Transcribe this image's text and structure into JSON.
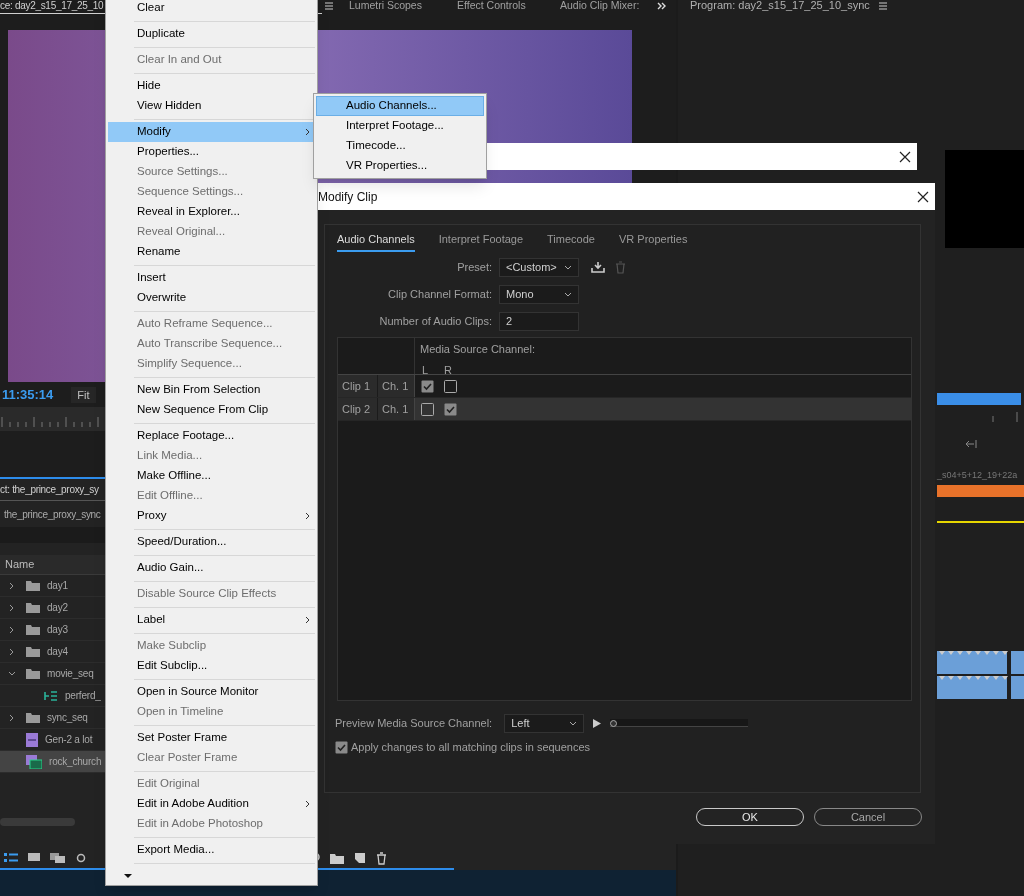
{
  "app": {
    "source_tab": {
      "label": "ce: day2_s15_17_25_10",
      "selected": true
    },
    "panel_tabs": [
      {
        "label": "Lumetri Scopes",
        "selected": false
      },
      {
        "label": "Effect Controls",
        "selected": false
      },
      {
        "label": "Audio Clip Mixer:",
        "selected": false
      }
    ],
    "program_tab": "Program: day2_s15_17_25_10_sync",
    "source_timecode": "11:35:14",
    "zoom": "Fit",
    "project_title": "ct: the_prince_proxy_sy",
    "project_path": "the_prince_proxy_sync",
    "name_column": "Name",
    "items": [
      {
        "kind": "folder",
        "label": "day1",
        "expanded": false,
        "selected": false
      },
      {
        "kind": "folder",
        "label": "day2",
        "expanded": false,
        "selected": false
      },
      {
        "kind": "folder",
        "label": "day3",
        "expanded": false,
        "selected": false
      },
      {
        "kind": "folder",
        "label": "day4",
        "expanded": false,
        "selected": false
      },
      {
        "kind": "folder",
        "label": "movie_seq",
        "expanded": true,
        "selected": false,
        "children": [
          {
            "kind": "sequence",
            "label": "perferd_",
            "selected": false
          }
        ]
      },
      {
        "kind": "folder",
        "label": "sync_seq",
        "expanded": false,
        "selected": false
      },
      {
        "kind": "clip",
        "label": "Gen-2 a lot",
        "selected": false
      },
      {
        "kind": "multicam",
        "label": "rock_church",
        "selected": true
      }
    ],
    "timeline_clip": "_s04+5+12_19+22a"
  },
  "context_menu": {
    "groups": [
      [
        {
          "label": "Clear",
          "disabled": false,
          "selected": false,
          "submenu": false
        }
      ],
      [
        {
          "label": "Duplicate",
          "disabled": false,
          "selected": false,
          "submenu": false
        }
      ],
      [
        {
          "label": "Clear In and Out",
          "disabled": true,
          "selected": false,
          "submenu": false
        }
      ],
      [
        {
          "label": "Hide",
          "disabled": false,
          "selected": false,
          "submenu": false
        },
        {
          "label": "View Hidden",
          "disabled": false,
          "selected": false,
          "submenu": false
        }
      ],
      [
        {
          "label": "Modify",
          "disabled": false,
          "selected": true,
          "submenu": true
        },
        {
          "label": "Properties...",
          "disabled": false,
          "selected": false,
          "submenu": false
        },
        {
          "label": "Source Settings...",
          "disabled": true,
          "selected": false,
          "submenu": false
        },
        {
          "label": "Sequence Settings...",
          "disabled": true,
          "selected": false,
          "submenu": false
        },
        {
          "label": "Reveal in Explorer...",
          "disabled": false,
          "selected": false,
          "submenu": false
        },
        {
          "label": "Reveal Original...",
          "disabled": true,
          "selected": false,
          "submenu": false
        },
        {
          "label": "Rename",
          "disabled": false,
          "selected": false,
          "submenu": false
        }
      ],
      [
        {
          "label": "Insert",
          "disabled": false,
          "selected": false,
          "submenu": false
        },
        {
          "label": "Overwrite",
          "disabled": false,
          "selected": false,
          "submenu": false
        }
      ],
      [
        {
          "label": "Auto Reframe Sequence...",
          "disabled": true,
          "selected": false,
          "submenu": false
        },
        {
          "label": "Auto Transcribe Sequence...",
          "disabled": true,
          "selected": false,
          "submenu": false
        },
        {
          "label": "Simplify Sequence...",
          "disabled": true,
          "selected": false,
          "submenu": false
        }
      ],
      [
        {
          "label": "New Bin From Selection",
          "disabled": false,
          "selected": false,
          "submenu": false
        },
        {
          "label": "New Sequence From Clip",
          "disabled": false,
          "selected": false,
          "submenu": false
        }
      ],
      [
        {
          "label": "Replace Footage...",
          "disabled": false,
          "selected": false,
          "submenu": false
        },
        {
          "label": "Link Media...",
          "disabled": true,
          "selected": false,
          "submenu": false
        },
        {
          "label": "Make Offline...",
          "disabled": false,
          "selected": false,
          "submenu": false
        },
        {
          "label": "Edit Offline...",
          "disabled": true,
          "selected": false,
          "submenu": false
        },
        {
          "label": "Proxy",
          "disabled": false,
          "selected": false,
          "submenu": true
        }
      ],
      [
        {
          "label": "Speed/Duration...",
          "disabled": false,
          "selected": false,
          "submenu": false
        }
      ],
      [
        {
          "label": "Audio Gain...",
          "disabled": false,
          "selected": false,
          "submenu": false
        }
      ],
      [
        {
          "label": "Disable Source Clip Effects",
          "disabled": true,
          "selected": false,
          "submenu": false
        }
      ],
      [
        {
          "label": "Label",
          "disabled": false,
          "selected": false,
          "submenu": true
        }
      ],
      [
        {
          "label": "Make Subclip",
          "disabled": true,
          "selected": false,
          "submenu": false
        },
        {
          "label": "Edit Subclip...",
          "disabled": false,
          "selected": false,
          "submenu": false
        }
      ],
      [
        {
          "label": "Open in Source Monitor",
          "disabled": false,
          "selected": false,
          "submenu": false
        },
        {
          "label": "Open in Timeline",
          "disabled": true,
          "selected": false,
          "submenu": false
        }
      ],
      [
        {
          "label": "Set Poster Frame",
          "disabled": false,
          "selected": false,
          "submenu": false
        },
        {
          "label": "Clear Poster Frame",
          "disabled": true,
          "selected": false,
          "submenu": false
        }
      ],
      [
        {
          "label": "Edit Original",
          "disabled": true,
          "selected": false,
          "submenu": false
        },
        {
          "label": "Edit in Adobe Audition",
          "disabled": false,
          "selected": false,
          "submenu": true
        },
        {
          "label": "Edit in Adobe Photoshop",
          "disabled": true,
          "selected": false,
          "submenu": false
        }
      ],
      [
        {
          "label": "Export Media...",
          "disabled": false,
          "selected": false,
          "submenu": false
        }
      ]
    ]
  },
  "submenu": {
    "items": [
      {
        "label": "Audio Channels...",
        "selected": true
      },
      {
        "label": "Interpret Footage...",
        "selected": false
      },
      {
        "label": "Timecode...",
        "selected": false
      },
      {
        "label": "VR Properties...",
        "selected": false
      }
    ]
  },
  "dialog": {
    "title": "Modify Clip",
    "tabs": [
      {
        "label": "Audio Channels",
        "selected": true
      },
      {
        "label": "Interpret Footage",
        "selected": false
      },
      {
        "label": "Timecode",
        "selected": false
      },
      {
        "label": "VR Properties",
        "selected": false
      }
    ],
    "preset": {
      "label": "Preset:",
      "value": "<Custom>"
    },
    "format": {
      "label": "Clip Channel Format:",
      "value": "Mono"
    },
    "clips": {
      "label": "Number of Audio Clips:",
      "value": "2"
    },
    "table": {
      "header": "Media Source Channel:",
      "columns": [
        "L",
        "R"
      ],
      "rows": [
        {
          "clip": "Clip 1",
          "channel": "Ch. 1",
          "selected": false,
          "checks": [
            true,
            false
          ]
        },
        {
          "clip": "Clip 2",
          "channel": "Ch. 1",
          "selected": true,
          "checks": [
            false,
            true
          ]
        }
      ]
    },
    "preview": {
      "label": "Preview Media Source Channel:",
      "value": "Left",
      "level": 0
    },
    "apply": {
      "label": "Apply changes to all matching clips in sequences",
      "checked": true
    },
    "buttons": [
      "OK",
      "Cancel"
    ]
  }
}
